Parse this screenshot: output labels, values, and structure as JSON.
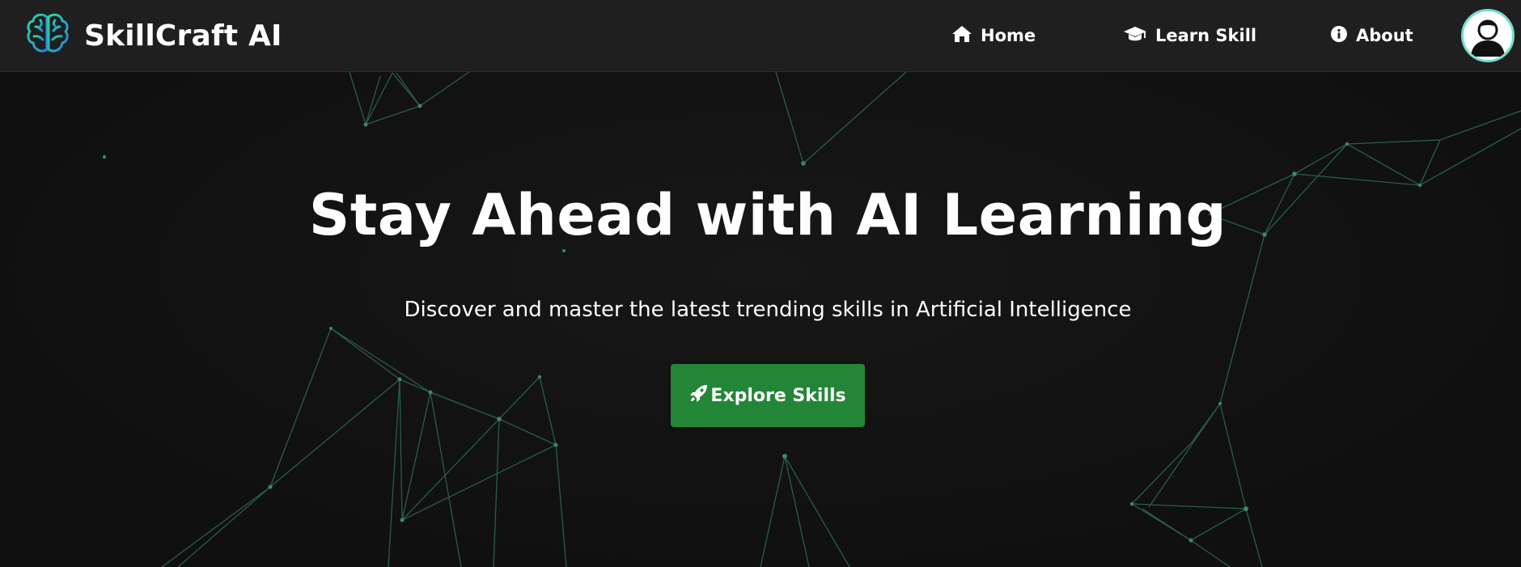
{
  "brand": {
    "name": "SkillCraft AI",
    "logo_icon": "brain-icon"
  },
  "nav": {
    "items": [
      {
        "label": "Home",
        "icon": "home-icon"
      },
      {
        "label": "Learn Skill",
        "icon": "graduation-cap-icon"
      },
      {
        "label": "About",
        "icon": "info-icon"
      }
    ],
    "profile_icon": "user-avatar-icon"
  },
  "hero": {
    "title": "Stay Ahead with AI Learning",
    "subtitle": "Discover and master the latest trending skills in Artificial Intelligence",
    "cta_label": "Explore Skills",
    "cta_icon": "rocket-icon"
  },
  "colors": {
    "navbar_bg": "#1f1f1f",
    "hero_bg": "#121212",
    "accent_green": "#238636",
    "network_line": "#2f6b4f",
    "avatar_ring": "#6fe0c8"
  }
}
